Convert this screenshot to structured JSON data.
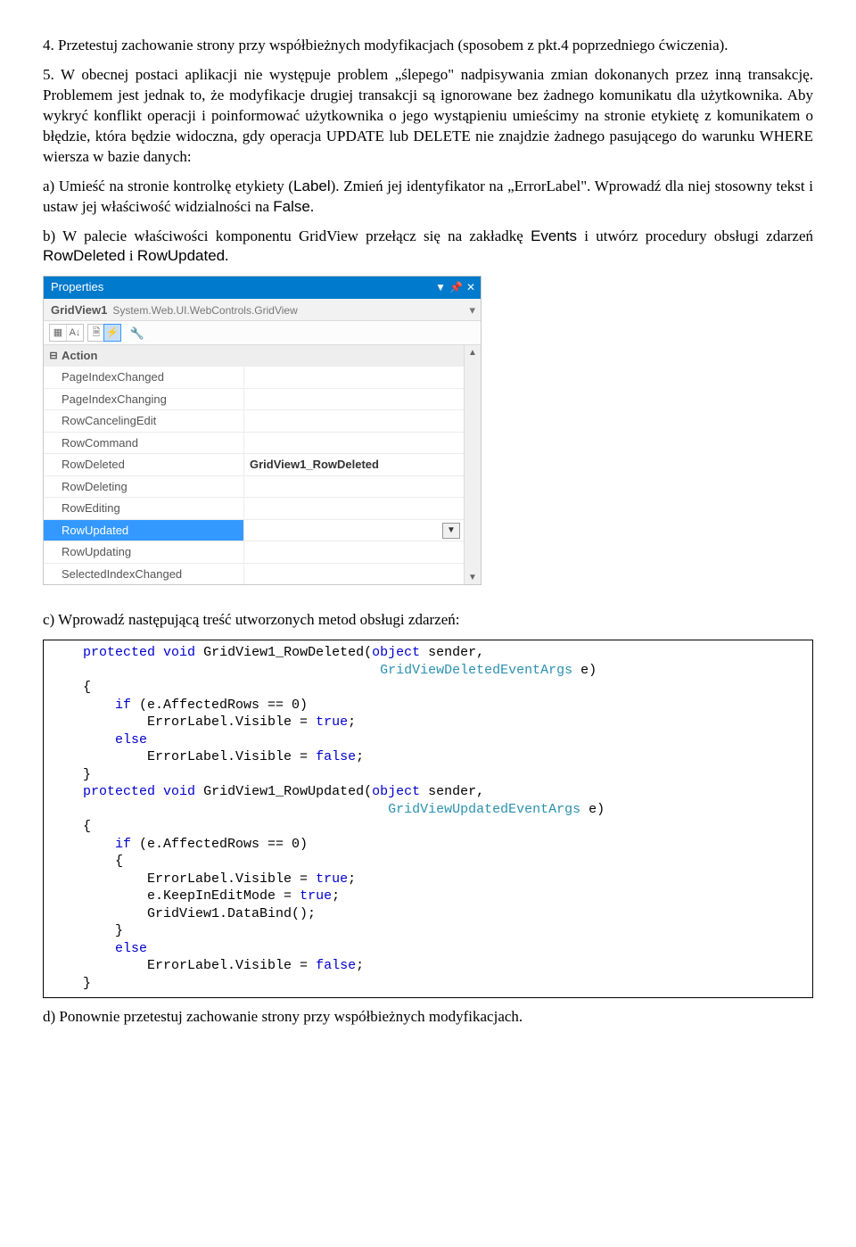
{
  "para1": "4. Przetestuj zachowanie strony przy współbieżnych modyfikacjach (sposobem z pkt.4 poprzedniego ćwiczenia).",
  "para2": "5. W obecnej postaci aplikacji nie występuje problem „ślepego\" nadpisywania zmian dokonanych przez inną transakcję. Problemem jest jednak to, że modyfikacje drugiej transakcji są ignorowane bez żadnego komunikatu dla użytkownika. Aby wykryć konflikt operacji i poinformować użytkownika o jego wystąpieniu umieścimy na stronie etykietę z komunikatem o błędzie, która będzie widoczna, gdy operacja UPDATE lub DELETE nie znajdzie żadnego pasującego do warunku WHERE wiersza w bazie danych:",
  "para_a_before": "a) Umieść na stronie kontrolkę etykiety (",
  "para_a_label": "Label",
  "para_a_mid": "). Zmień jej identyfikator na „ErrorLabel\". Wprowadź dla niej stosowny tekst i ustaw jej właściwość widzialności na ",
  "para_a_false": "False",
  "para_a_after": ".",
  "para_b_before": "b) W palecie właściwości komponentu GridView przełącz się na zakładkę ",
  "para_b_events": "Events",
  "para_b_mid": " i utwórz procedury obsługi zdarzeń ",
  "para_b_ev1": "RowDeleted",
  "para_b_and": " i ",
  "para_b_ev2": "RowUpdated",
  "para_b_after": ".",
  "props": {
    "title": "Properties",
    "obj_name": "GridView1",
    "obj_type": "System.Web.UI.WebControls.GridView",
    "category": "Action",
    "rows": [
      {
        "name": "PageIndexChanged",
        "val": ""
      },
      {
        "name": "PageIndexChanging",
        "val": ""
      },
      {
        "name": "RowCancelingEdit",
        "val": ""
      },
      {
        "name": "RowCommand",
        "val": ""
      },
      {
        "name": "RowDeleted",
        "val": "GridView1_RowDeleted"
      },
      {
        "name": "RowDeleting",
        "val": ""
      },
      {
        "name": "RowEditing",
        "val": ""
      },
      {
        "name": "RowUpdated",
        "val": ""
      },
      {
        "name": "RowUpdating",
        "val": ""
      },
      {
        "name": "SelectedIndexChanged",
        "val": ""
      }
    ]
  },
  "para_c": "c) Wprowadź następującą treść utworzonych metod obsługi zdarzeń:",
  "code": {
    "l1": {
      "indent": "    ",
      "kw1": "protected",
      "kw2": "void",
      "name": " GridView1_RowDeleted(",
      "t1": "object",
      "mid": " sender,"
    },
    "l2": {
      "indent": "                                         ",
      "t2": "GridViewDeletedEventArgs",
      "tail": " e)"
    },
    "l3": "    {",
    "l4": {
      "indent": "        ",
      "kw": "if",
      "tail": " (e.AffectedRows == 0)"
    },
    "l5": {
      "indent": "            ",
      "txt": "ErrorLabel.Visible = ",
      "kw": "true",
      "tail": ";"
    },
    "l6": {
      "indent": "        ",
      "kw": "else"
    },
    "l7": {
      "indent": "            ",
      "txt": "ErrorLabel.Visible = ",
      "kw": "false",
      "tail": ";"
    },
    "l8": "    }",
    "l9": {
      "indent": "    ",
      "kw1": "protected",
      "kw2": "void",
      "name": " GridView1_RowUpdated(",
      "t1": "object",
      "mid": " sender,"
    },
    "l10": {
      "indent": "                                          ",
      "t2": "GridViewUpdatedEventArgs",
      "tail": " e)"
    },
    "l11": "    {",
    "l12": {
      "indent": "        ",
      "kw": "if",
      "tail": " (e.AffectedRows == 0)"
    },
    "l13": "        {",
    "l14": {
      "indent": "            ",
      "txt": "ErrorLabel.Visible = ",
      "kw": "true",
      "tail": ";"
    },
    "l15": {
      "indent": "            ",
      "txt": "e.KeepInEditMode = ",
      "kw": "true",
      "tail": ";"
    },
    "l16": "            GridView1.DataBind();",
    "l17": "        }",
    "l18": {
      "indent": "        ",
      "kw": "else"
    },
    "l19": {
      "indent": "            ",
      "txt": "ErrorLabel.Visible = ",
      "kw": "false",
      "tail": ";"
    },
    "l20": "    }"
  },
  "para_d": "d) Ponownie przetestuj zachowanie strony przy współbieżnych modyfikacjach."
}
